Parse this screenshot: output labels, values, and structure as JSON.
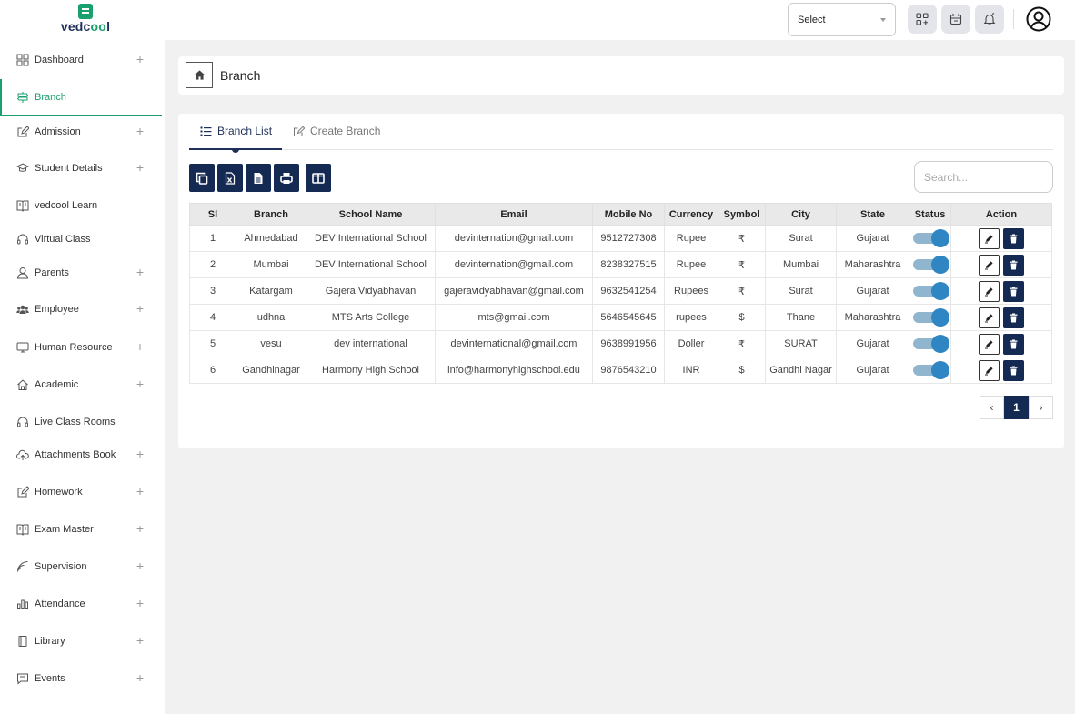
{
  "brand": {
    "name_prefix": "vedc",
    "name_mid": "oo",
    "name_suffix": "l"
  },
  "header": {
    "select_value": "Select",
    "icons": [
      "apps-add-icon",
      "calendar-icon",
      "bell-icon",
      "user-circle-icon"
    ]
  },
  "sidebar": {
    "items": [
      {
        "label": "Dashboard",
        "icon": "grid-icon",
        "expandable": true
      },
      {
        "label": "Branch",
        "icon": "signpost-icon",
        "expandable": false,
        "active": true
      },
      {
        "label": "Admission",
        "icon": "edit-icon",
        "expandable": true
      },
      {
        "label": "Student Details",
        "icon": "graduation-cap-icon",
        "expandable": true
      },
      {
        "label": "vedcool Learn",
        "icon": "book-icon",
        "expandable": false
      },
      {
        "label": "Virtual Class",
        "icon": "headset-icon",
        "expandable": false
      },
      {
        "label": "Parents",
        "icon": "user-icon",
        "expandable": true
      },
      {
        "label": "Employee",
        "icon": "users-icon",
        "expandable": true
      },
      {
        "label": "Human Resource",
        "icon": "monitor-icon",
        "expandable": true
      },
      {
        "label": "Academic",
        "icon": "home-icon",
        "expandable": true
      },
      {
        "label": "Live Class Rooms",
        "icon": "headset-icon",
        "expandable": false
      },
      {
        "label": "Attachments Book",
        "icon": "cloud-upload-icon",
        "expandable": true
      },
      {
        "label": "Homework",
        "icon": "edit-icon",
        "expandable": true
      },
      {
        "label": "Exam Master",
        "icon": "book-icon",
        "expandable": true
      },
      {
        "label": "Supervision",
        "icon": "wifi-icon",
        "expandable": true
      },
      {
        "label": "Attendance",
        "icon": "bar-chart-icon",
        "expandable": true
      },
      {
        "label": "Library",
        "icon": "book-closed-icon",
        "expandable": true
      },
      {
        "label": "Events",
        "icon": "message-icon",
        "expandable": true
      }
    ],
    "plus_symbol": "+"
  },
  "breadcrumb": {
    "title": "Branch"
  },
  "tabs": [
    {
      "label": "Branch List",
      "active": true
    },
    {
      "label": "Create Branch",
      "active": false
    }
  ],
  "toolbar": {
    "buttons": [
      "copy-icon",
      "excel-icon",
      "csv-icon",
      "print-icon",
      "columns-icon"
    ]
  },
  "search": {
    "placeholder": "Search..."
  },
  "table": {
    "columns": [
      "Sl",
      "Branch",
      "School Name",
      "Email",
      "Mobile No",
      "Currency",
      "Symbol",
      "City",
      "State",
      "Status",
      "Action"
    ],
    "rows": [
      [
        "1",
        "Ahmedabad",
        "DEV International School",
        "devinternation@gmail.com",
        "9512727308",
        "Rupee",
        "₹",
        "Surat",
        "Gujarat"
      ],
      [
        "2",
        "Mumbai",
        "DEV International School",
        "devinternation@gmail.com",
        "8238327515",
        "Rupee",
        "₹",
        "Mumbai",
        "Maharashtra"
      ],
      [
        "3",
        "Katargam",
        "Gajera Vidyabhavan",
        "gajeravidyabhavan@gmail.com",
        "9632541254",
        "Rupees",
        "₹",
        "Surat",
        "Gujarat"
      ],
      [
        "4",
        "udhna",
        "MTS Arts College",
        "mts@gmail.com",
        "5646545645",
        "rupees",
        "$",
        "Thane",
        "Maharashtra"
      ],
      [
        "5",
        "vesu",
        "dev international",
        "devinternational@gmail.com",
        "9638991956",
        "Doller",
        "₹",
        "SURAT",
        "Gujarat"
      ],
      [
        "6",
        "Gandhinagar",
        "Harmony High School",
        "info@harmonyhighschool.edu",
        "9876543210",
        "INR",
        "$",
        "Gandhi Nagar",
        "Gujarat"
      ]
    ],
    "status_on": [
      true,
      true,
      true,
      true,
      true,
      true
    ]
  },
  "pagination": {
    "prev": "‹",
    "current": "1",
    "next": "›"
  },
  "colors": {
    "brand_green": "#1aa06d",
    "navy": "#152a52",
    "toggle": "#2f86c2"
  }
}
